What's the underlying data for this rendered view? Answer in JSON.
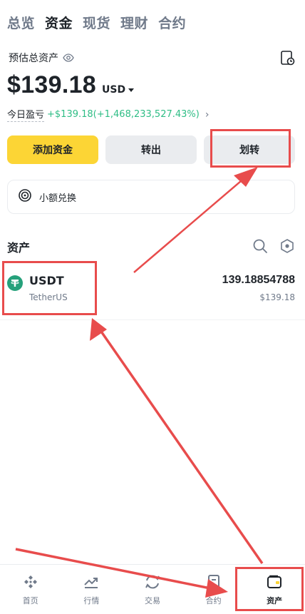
{
  "top_tabs": [
    {
      "label": "总览",
      "active": false
    },
    {
      "label": "资金",
      "active": true
    },
    {
      "label": "现货",
      "active": false
    },
    {
      "label": "理财",
      "active": false
    },
    {
      "label": "合约",
      "active": false
    }
  ],
  "summary": {
    "estimated_label": "预估总资产",
    "balance": "$139.18",
    "currency": "USD",
    "pnl_label": "今日盈亏",
    "pnl_value": "+$139.18(+1,468,233,527.43%)"
  },
  "actions": {
    "deposit": "添加资金",
    "withdraw": "转出",
    "transfer": "划转"
  },
  "small_exchange": {
    "label": "小额兑换"
  },
  "assets": {
    "title": "资产",
    "items": [
      {
        "symbol": "USDT",
        "name": "TetherUS",
        "amount": "139.18854788",
        "value": "$139.18"
      }
    ]
  },
  "bottom_nav": [
    {
      "label": "首页",
      "icon": "home-icon",
      "active": false
    },
    {
      "label": "行情",
      "icon": "markets-icon",
      "active": false
    },
    {
      "label": "交易",
      "icon": "trade-icon",
      "active": false
    },
    {
      "label": "合约",
      "icon": "futures-icon",
      "active": false
    },
    {
      "label": "资产",
      "icon": "wallet-icon",
      "active": true
    }
  ],
  "colors": {
    "accent": "#fcd535",
    "profit": "#2ebd85",
    "annotation": "#e84c4c",
    "usdt": "#26a17b"
  }
}
